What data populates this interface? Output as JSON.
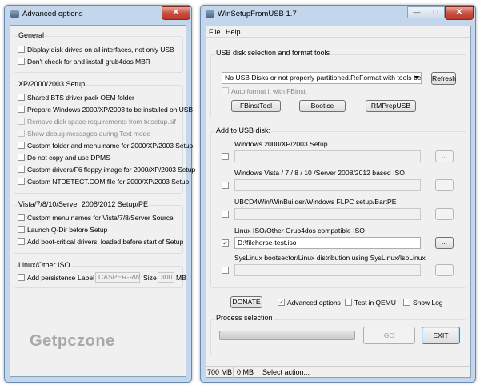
{
  "advanced": {
    "title": "Advanced options",
    "close": "✕",
    "general": {
      "label": "General",
      "items": [
        "Display disk drives on all interfaces, not only USB",
        "Don't check for and install grub4dos MBR"
      ]
    },
    "xp": {
      "label": "XP/2000/2003 Setup",
      "items": [
        "Shared BTS driver pack OEM folder",
        "Prepare Windows 2000/XP/2003 to be installed on USB",
        "Remove disk space requirements from txtsetup.sif",
        "Show debug messages during Text mode",
        "Custom folder and menu name for 2000/XP/2003 Setup",
        "Do not copy and use DPMS",
        "Custom drivers/F6 floppy image for 2000/XP/2003 Setup",
        "Custom NTDETECT.COM file for 2000/XP/2003 Setup"
      ]
    },
    "vista": {
      "label": "Vista/7/8/10/Server 2008/2012 Setup/PE",
      "items": [
        "Custom menu names for Vista/7/8/Server Source",
        "Launch Q-Dir before Setup",
        "Add boot-critical drivers, loaded before start of Setup"
      ]
    },
    "linux": {
      "label": "Linux/Other ISO",
      "persistence_label": "Add persistence",
      "label_label": "Label",
      "label_value": "CASPER-RW",
      "size_label": "Size",
      "size_value": "300",
      "size_unit": "MB"
    },
    "watermark": "Getpczone"
  },
  "main": {
    "title": "WinSetupFromUSB 1.7",
    "buttons": {
      "minimize": "—",
      "maximize": "□",
      "close": "✕"
    },
    "menu": [
      "File",
      "Help"
    ],
    "usb_section": {
      "label": "USB disk selection and format tools",
      "disk_select_value": "No USB Disks or not properly partitioned.ReFormat with tools below",
      "refresh": "Refresh",
      "auto_format": "Auto format it with FBinst",
      "tools": [
        "FBinstTool",
        "Bootice",
        "RMPrepUSB"
      ]
    },
    "add_section": {
      "label": "Add to USB disk:",
      "rows": [
        {
          "label": "Windows 2000/XP/2003 Setup",
          "path": "",
          "checked": false
        },
        {
          "label": "Windows Vista / 7 / 8 / 10 /Server 2008/2012 based ISO",
          "path": "",
          "checked": false
        },
        {
          "label": "UBCD4Win/WinBuilder/Windows FLPC setup/BartPE",
          "path": "",
          "checked": false
        },
        {
          "label": "Linux ISO/Other Grub4dos compatible ISO",
          "path": "D:\\filehorse-test.iso",
          "checked": true
        },
        {
          "label": "SysLinux bootsector/Linux distribution using SysLinux/IsoLinux",
          "path": "",
          "checked": false
        }
      ],
      "browse": "..."
    },
    "donate": "DONATE",
    "options": [
      {
        "label": "Advanced options",
        "checked": true
      },
      {
        "label": "Test in QEMU",
        "checked": false
      },
      {
        "label": "Show Log",
        "checked": false
      }
    ],
    "process": {
      "label": "Process selection",
      "progress": 0,
      "go": "GO",
      "exit": "EXIT"
    },
    "status": [
      "700 MB",
      "0 MB",
      "Select action..."
    ]
  }
}
